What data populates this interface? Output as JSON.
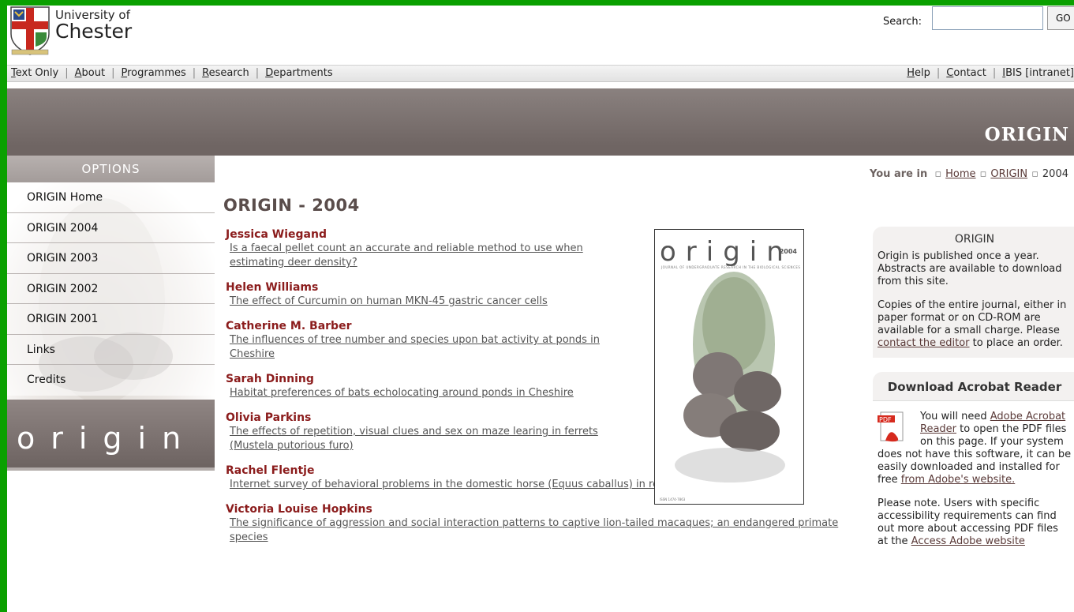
{
  "header": {
    "university_line1": "University of",
    "university_line2": "Chester",
    "search_label": "Search:",
    "search_value": "",
    "go_label": "GO"
  },
  "nav": {
    "left": [
      {
        "label": "Text Only"
      },
      {
        "label": "About"
      },
      {
        "label": "Programmes"
      },
      {
        "label": "Research"
      },
      {
        "label": "Departments"
      }
    ],
    "right": [
      {
        "label": "Help"
      },
      {
        "label": "Contact"
      },
      {
        "label": "IBIS [intranet]"
      }
    ]
  },
  "banner": {
    "title": "ORIGIN"
  },
  "sidebar": {
    "heading": "OPTIONS",
    "items": [
      {
        "label": "ORIGIN Home"
      },
      {
        "label": "ORIGIN 2004"
      },
      {
        "label": "ORIGIN 2003"
      },
      {
        "label": "ORIGIN 2002"
      },
      {
        "label": "ORIGIN 2001"
      },
      {
        "label": "Links"
      },
      {
        "label": "Credits"
      }
    ],
    "logo_text": "origin"
  },
  "breadcrumb": {
    "prefix": "You are in",
    "items": [
      {
        "label": "Home"
      },
      {
        "label": "ORIGIN"
      }
    ],
    "current": "2004"
  },
  "main": {
    "title": "ORIGIN - 2004",
    "articles": [
      {
        "author": "Jessica Wiegand",
        "title": "Is a faecal pellet count an accurate and reliable method to use when estimating deer density?"
      },
      {
        "author": "Helen Williams",
        "title": "The effect of Curcumin on human MKN-45 gastric cancer cells"
      },
      {
        "author": "Catherine M. Barber",
        "title": "The influences of tree number and species upon bat activity at ponds in Cheshire"
      },
      {
        "author": "Sarah Dinning",
        "title": "Habitat preferences of bats echolocating around ponds in Cheshire"
      },
      {
        "author": "Olivia Parkins",
        "title": "The effects of repetition, visual clues and sex on maze learing in ferrets (Mustela putorious furo)"
      },
      {
        "author": "Rachel Flentje",
        "title": "Internet survey of behavioral problems in the domestic horse (Equus caballus) in relation to their management"
      },
      {
        "author": "Victoria Louise Hopkins",
        "title": "The significance of aggression and social interaction patterns to captive lion-tailed macaques; an endangered primate species"
      }
    ]
  },
  "cover": {
    "word": "origin",
    "year": "2004",
    "subtitle": "JOURNAL OF UNDERGRADUATE RESEARCH IN THE BIOLOGICAL SCIENCES",
    "issn": "ISSN 1474-7863"
  },
  "right": {
    "origin_box": {
      "heading": "ORIGIN",
      "p1": "Origin is published once a year. Abstracts are available to download from this site.",
      "p2_before": "Copies of the entire journal, either in paper format or on CD-ROM are available for a small charge. Please ",
      "p2_link": "contact the editor",
      "p2_after": " to place an order."
    },
    "acrobat_box": {
      "heading": "Download Acrobat Reader",
      "t1_before": "You will need ",
      "t1_link": "Adobe Acrobat Reader",
      "t1_after": " to open the PDF files on this page. If your system does not have this software, it can be easily downloaded and installed for free ",
      "t1_link2": "from Adobe's website.",
      "t2_before": "Please note. Users with specific accessibility requirements can find out more about accessing PDF files at the ",
      "t2_link": "Access Adobe website"
    }
  }
}
